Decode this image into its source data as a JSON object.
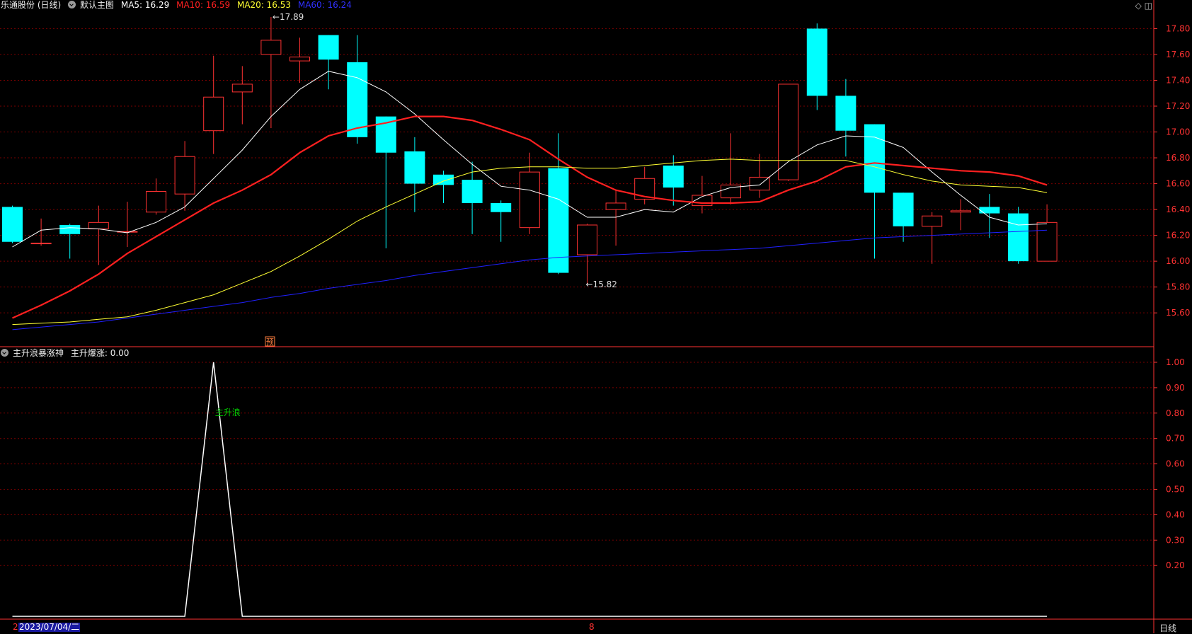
{
  "header": {
    "stock_title": "乐通股份 (日线)",
    "main_chart_label": "默认主图",
    "ma": [
      {
        "label": "MA5: 16.29",
        "color": "#ffffff"
      },
      {
        "label": "MA10: 16.59",
        "color": "#ff2020"
      },
      {
        "label": "MA20: 16.53",
        "color": "#ffff33"
      },
      {
        "label": "MA60: 16.24",
        "color": "#3030ff"
      }
    ]
  },
  "indicator_header": {
    "name": "主升浪暴涨神",
    "value_label": "主升爆涨: 0.00"
  },
  "footer": {
    "left_mark": "2",
    "date": "2023/07/04/二",
    "mid_mark": "8",
    "period": "日线"
  },
  "colors": {
    "up": "#ff3232",
    "down": "#00ffff",
    "grid": "#7a0000",
    "axis": "#ff3232",
    "indicator_line": "#ffffff",
    "indicator_text": "#00d000"
  },
  "chart_data": [
    {
      "type": "candlestick",
      "y_ticks": [
        "17.80",
        "17.60",
        "17.40",
        "17.20",
        "17.00",
        "16.80",
        "16.60",
        "16.40",
        "16.20",
        "16.00",
        "15.80",
        "15.60"
      ],
      "ylim": [
        15.45,
        17.97
      ],
      "candles": [
        {
          "o": 16.42,
          "h": 16.43,
          "l": 16.14,
          "c": 16.15
        },
        {
          "o": 16.14,
          "h": 16.33,
          "l": 16.12,
          "c": 16.14
        },
        {
          "o": 16.28,
          "h": 16.29,
          "l": 16.02,
          "c": 16.21
        },
        {
          "o": 16.25,
          "h": 16.43,
          "l": 15.97,
          "c": 16.3
        },
        {
          "o": 16.23,
          "h": 16.46,
          "l": 16.11,
          "c": 16.23
        },
        {
          "o": 16.38,
          "h": 16.64,
          "l": 16.36,
          "c": 16.54
        },
        {
          "o": 16.52,
          "h": 16.93,
          "l": 16.39,
          "c": 16.81
        },
        {
          "o": 17.01,
          "h": 17.59,
          "l": 16.83,
          "c": 17.27
        },
        {
          "o": 17.31,
          "h": 17.51,
          "l": 17.06,
          "c": 17.37
        },
        {
          "o": 17.6,
          "h": 17.89,
          "l": 17.03,
          "c": 17.71
        },
        {
          "o": 17.55,
          "h": 17.73,
          "l": 17.38,
          "c": 17.58
        },
        {
          "o": 17.75,
          "h": 17.75,
          "l": 17.33,
          "c": 17.56
        },
        {
          "o": 17.54,
          "h": 17.75,
          "l": 16.91,
          "c": 16.96
        },
        {
          "o": 17.12,
          "h": 17.12,
          "l": 16.1,
          "c": 16.84
        },
        {
          "o": 16.85,
          "h": 16.96,
          "l": 16.38,
          "c": 16.6
        },
        {
          "o": 16.67,
          "h": 16.7,
          "l": 16.45,
          "c": 16.59
        },
        {
          "o": 16.63,
          "h": 16.77,
          "l": 16.21,
          "c": 16.45
        },
        {
          "o": 16.45,
          "h": 16.47,
          "l": 16.15,
          "c": 16.38
        },
        {
          "o": 16.26,
          "h": 16.84,
          "l": 16.21,
          "c": 16.69
        },
        {
          "o": 16.72,
          "h": 16.99,
          "l": 15.9,
          "c": 15.91
        },
        {
          "o": 16.05,
          "h": 16.29,
          "l": 15.82,
          "c": 16.28
        },
        {
          "o": 16.4,
          "h": 16.55,
          "l": 16.12,
          "c": 16.45
        },
        {
          "o": 16.48,
          "h": 16.73,
          "l": 16.44,
          "c": 16.64
        },
        {
          "o": 16.74,
          "h": 16.82,
          "l": 16.43,
          "c": 16.57
        },
        {
          "o": 16.43,
          "h": 16.66,
          "l": 16.37,
          "c": 16.51
        },
        {
          "o": 16.49,
          "h": 16.99,
          "l": 16.44,
          "c": 16.59
        },
        {
          "o": 16.55,
          "h": 16.83,
          "l": 16.49,
          "c": 16.65
        },
        {
          "o": 16.63,
          "h": 17.37,
          "l": 16.62,
          "c": 17.37
        },
        {
          "o": 17.8,
          "h": 17.84,
          "l": 17.17,
          "c": 17.28
        },
        {
          "o": 17.28,
          "h": 17.41,
          "l": 16.81,
          "c": 17.01
        },
        {
          "o": 17.06,
          "h": 17.06,
          "l": 16.02,
          "c": 16.53
        },
        {
          "o": 16.53,
          "h": 16.53,
          "l": 16.15,
          "c": 16.27
        },
        {
          "o": 16.27,
          "h": 16.38,
          "l": 15.98,
          "c": 16.35
        },
        {
          "o": 16.38,
          "h": 16.48,
          "l": 16.24,
          "c": 16.39
        },
        {
          "o": 16.42,
          "h": 16.52,
          "l": 16.18,
          "c": 16.37
        },
        {
          "o": 16.37,
          "h": 16.42,
          "l": 15.98,
          "c": 16.0
        },
        {
          "o": 16.0,
          "h": 16.44,
          "l": 16.0,
          "c": 16.3
        }
      ],
      "series": [
        {
          "name": "MA5",
          "color": "#ffffff",
          "width": 1,
          "values": [
            16.11,
            16.24,
            16.26,
            16.25,
            16.22,
            16.3,
            16.42,
            16.64,
            16.86,
            17.12,
            17.33,
            17.47,
            17.42,
            17.31,
            17.14,
            16.94,
            16.75,
            16.58,
            16.55,
            16.48,
            16.34,
            16.34,
            16.4,
            16.38,
            16.5,
            16.57,
            16.59,
            16.77,
            16.9,
            16.97,
            16.96,
            16.88,
            16.69,
            16.51,
            16.34,
            16.28,
            16.29
          ]
        },
        {
          "name": "MA10",
          "color": "#ff2020",
          "width": 2.2,
          "values": [
            15.56,
            15.66,
            15.77,
            15.9,
            16.06,
            16.19,
            16.32,
            16.45,
            16.55,
            16.67,
            16.84,
            16.97,
            17.03,
            17.07,
            17.12,
            17.12,
            17.09,
            17.02,
            16.94,
            16.79,
            16.65,
            16.55,
            16.5,
            16.47,
            16.45,
            16.45,
            16.46,
            16.55,
            16.62,
            16.73,
            16.76,
            16.74,
            16.72,
            16.7,
            16.69,
            16.66,
            16.59
          ]
        },
        {
          "name": "MA20",
          "color": "#ffff33",
          "width": 1,
          "values": [
            15.51,
            15.52,
            15.53,
            15.55,
            15.57,
            15.62,
            15.68,
            15.74,
            15.83,
            15.92,
            16.04,
            16.17,
            16.31,
            16.42,
            16.52,
            16.62,
            16.69,
            16.72,
            16.73,
            16.73,
            16.72,
            16.72,
            16.74,
            16.76,
            16.78,
            16.79,
            16.78,
            16.78,
            16.78,
            16.78,
            16.73,
            16.67,
            16.62,
            16.59,
            16.58,
            16.57,
            16.53
          ]
        },
        {
          "name": "MA60",
          "color": "#2020ff",
          "width": 1,
          "values": [
            15.47,
            15.49,
            15.51,
            15.53,
            15.56,
            15.59,
            15.62,
            15.65,
            15.68,
            15.72,
            15.75,
            15.79,
            15.82,
            15.85,
            15.89,
            15.92,
            15.95,
            15.98,
            16.01,
            16.03,
            16.04,
            16.05,
            16.06,
            16.07,
            16.08,
            16.09,
            16.1,
            16.12,
            16.14,
            16.16,
            16.18,
            16.19,
            16.2,
            16.21,
            16.22,
            16.23,
            16.24
          ]
        }
      ],
      "annotations": [
        {
          "index": 9,
          "label": "17.89",
          "value": 17.89
        },
        {
          "index": 20,
          "label": "15.82",
          "value": 15.82
        },
        {
          "index": 9,
          "label": "预"
        }
      ]
    },
    {
      "type": "line",
      "name": "主升爆涨",
      "y_ticks": [
        "1.00",
        "0.90",
        "0.80",
        "0.70",
        "0.60",
        "0.50",
        "0.40",
        "0.30",
        "0.20"
      ],
      "ylim": [
        0.0,
        1.0
      ],
      "values": [
        0,
        0,
        0,
        0,
        0,
        0,
        0,
        1,
        0,
        0,
        0,
        0,
        0,
        0,
        0,
        0,
        0,
        0,
        0,
        0,
        0,
        0,
        0,
        0,
        0,
        0,
        0,
        0,
        0,
        0,
        0,
        0,
        0,
        0,
        0,
        0,
        0
      ],
      "annotations": [
        {
          "index": 7,
          "label": "主升浪"
        }
      ]
    }
  ]
}
